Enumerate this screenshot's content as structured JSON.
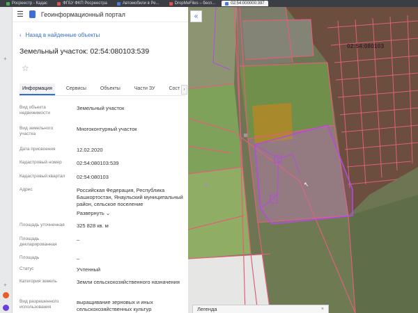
{
  "browser": {
    "tabs": [
      {
        "label": "Росреестр - Кадас"
      },
      {
        "label": "ФГБУ ФКП Росреестра"
      },
      {
        "label": "Автомобили в Ре..."
      },
      {
        "label": "DropMeFiles – бесп..."
      },
      {
        "label": "02:54:000000:397"
      }
    ]
  },
  "app": {
    "title": "Геоинформационный портал",
    "back_link": "Назад в найденные объекты",
    "page_title": "Земельный участок: 02:54:080103:539"
  },
  "tabs": [
    "Информация",
    "Сервисы",
    "Объекты",
    "Части ЗУ",
    "Сост"
  ],
  "tab_scroll": "›",
  "properties": [
    {
      "label": "Вид объекта недвижимости",
      "value": "Земельный участок"
    },
    {
      "label": "Вид земельного участка",
      "value": "Многоконтурный участок"
    },
    {
      "label": "Дата присвоения",
      "value": "12.02.2020"
    },
    {
      "label": "Кадастровый номер",
      "value": "02:54:080103:539"
    },
    {
      "label": "Кадастровый квартал",
      "value": "02:54:080103"
    },
    {
      "label": "Адрес",
      "value": "Российская Федерация, Республика Башкортостан, Янаульский муниципальный район, сельское поселение"
    },
    {
      "label": "Площадь уточненная",
      "value": "325 828 кв. м"
    },
    {
      "label": "Площадь декларированная",
      "value": "–"
    },
    {
      "label": "Площадь",
      "value": "–"
    },
    {
      "label": "Статус",
      "value": "Учтенный"
    },
    {
      "label": "Категория земель",
      "value": "Земли сельскохозяйственного назначения"
    },
    {
      "label": "Вид разрешенного использования",
      "value": "выращивание зерновых и иных сельскохозяйственных культур"
    }
  ],
  "expand_label": "Развернуть",
  "map": {
    "collapse_glyph": "«",
    "cadastral_label": "02:54:080103",
    "legend_label": "Легенда",
    "legend_close": "×"
  },
  "colors": {
    "accent": "#2f6fd0",
    "parcel_outline": "#e0607a",
    "selected_parcel": "#b44be0"
  }
}
